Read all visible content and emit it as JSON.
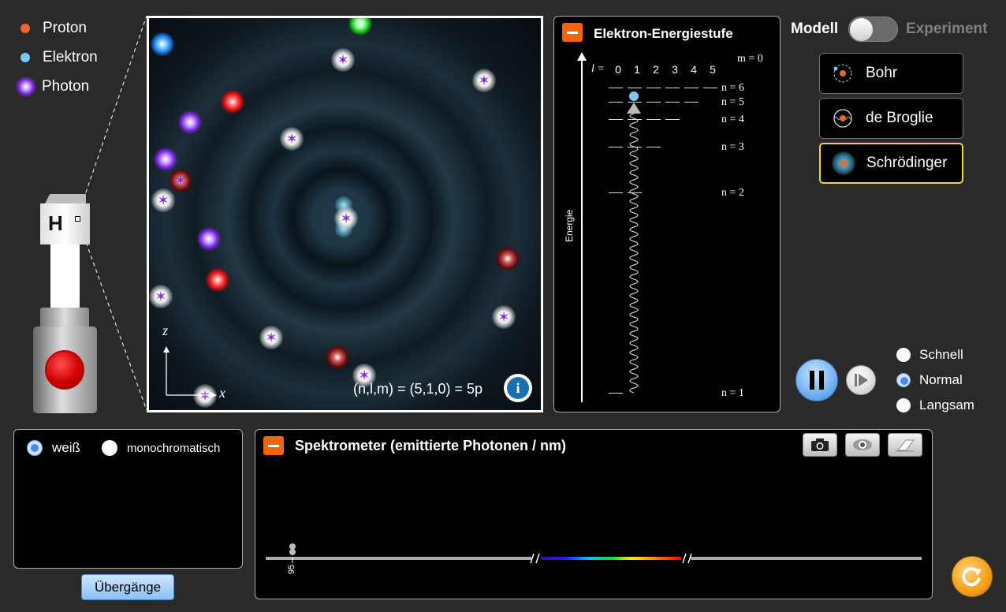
{
  "legend": {
    "proton_label": "Proton",
    "electron_label": "Elektron",
    "photon_label": "Photon",
    "proton_color": "#f2652b",
    "electron_color": "#7ec8f0",
    "photon_color": "#8a2be2"
  },
  "gun": {
    "element_label": "H"
  },
  "view": {
    "z_label": "z",
    "x_label": "x",
    "state_formula": "(n,l,m) = (5,1,0) = 5p"
  },
  "energy": {
    "title": "Elektron-Energiestufe",
    "l_label": "l =",
    "l_values": [
      "0",
      "1",
      "2",
      "3",
      "4",
      "5"
    ],
    "m_label": "m = 0",
    "axis_label": "Energie",
    "levels": [
      "n = 6",
      "n = 5",
      "n = 4",
      "n = 3",
      "n = 2",
      "n = 1"
    ]
  },
  "mode": {
    "model_label": "Modell",
    "experiment_label": "Experiment",
    "selected": "Modell"
  },
  "models": [
    {
      "label": "Bohr",
      "icon": "bohr-atom-icon"
    },
    {
      "label": "de Broglie",
      "icon": "de-broglie-atom-icon"
    },
    {
      "label": "Schrödinger",
      "icon": "schroedinger-atom-icon",
      "selected": true
    }
  ],
  "speed": {
    "options": [
      "Schnell",
      "Normal",
      "Langsam"
    ],
    "selected": "Normal"
  },
  "light": {
    "white_label": "weiß",
    "mono_label": "monochromatisch",
    "selected": "weiß"
  },
  "transitions_button": "Übergänge",
  "spectrometer": {
    "title": "Spektrometer (emittierte Photonen / nm)",
    "tick_label": "95",
    "photon_count": 2
  },
  "colors": {
    "accent_orange": "#f2650b",
    "selected_outline": "#f2d43b",
    "radio_blue": "#4a8be8"
  }
}
